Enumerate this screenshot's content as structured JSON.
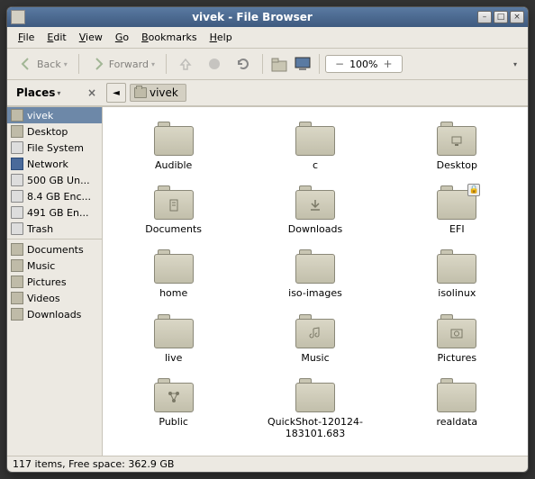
{
  "window": {
    "title": "vivek - File Browser"
  },
  "menu": {
    "file": "File",
    "edit": "Edit",
    "view": "View",
    "go": "Go",
    "bookmarks": "Bookmarks",
    "help": "Help"
  },
  "toolbar": {
    "back": "Back",
    "forward": "Forward",
    "zoom": "100%"
  },
  "location": {
    "places": "Places",
    "crumb": "vivek"
  },
  "sidebar": {
    "items": [
      {
        "label": "vivek",
        "icon": "folder",
        "sel": true
      },
      {
        "label": "Desktop",
        "icon": "folder"
      },
      {
        "label": "File System",
        "icon": "drive"
      },
      {
        "label": "Network",
        "icon": "net"
      },
      {
        "label": "500 GB Un...",
        "icon": "drive"
      },
      {
        "label": "8.4 GB Enc...",
        "icon": "drive"
      },
      {
        "label": "491 GB En...",
        "icon": "drive"
      },
      {
        "label": "Trash",
        "icon": "drive"
      }
    ],
    "bookmarks": [
      {
        "label": "Documents",
        "icon": "folder"
      },
      {
        "label": "Music",
        "icon": "folder"
      },
      {
        "label": "Pictures",
        "icon": "folder"
      },
      {
        "label": "Videos",
        "icon": "folder"
      },
      {
        "label": "Downloads",
        "icon": "folder"
      }
    ]
  },
  "files": [
    {
      "name": "Audible",
      "emblem": ""
    },
    {
      "name": "c",
      "emblem": ""
    },
    {
      "name": "Desktop",
      "emblem": "desktop"
    },
    {
      "name": "Documents",
      "emblem": "doc"
    },
    {
      "name": "Downloads",
      "emblem": "dl"
    },
    {
      "name": "EFI",
      "emblem": "",
      "lock": true
    },
    {
      "name": "home",
      "emblem": ""
    },
    {
      "name": "iso-images",
      "emblem": ""
    },
    {
      "name": "isolinux",
      "emblem": ""
    },
    {
      "name": "live",
      "emblem": ""
    },
    {
      "name": "Music",
      "emblem": "music"
    },
    {
      "name": "Pictures",
      "emblem": "pic"
    },
    {
      "name": "Public",
      "emblem": "share"
    },
    {
      "name": "QuickShot-120124-183101.683",
      "emblem": ""
    },
    {
      "name": "realdata",
      "emblem": ""
    }
  ],
  "status": "117 items, Free space: 362.9 GB"
}
